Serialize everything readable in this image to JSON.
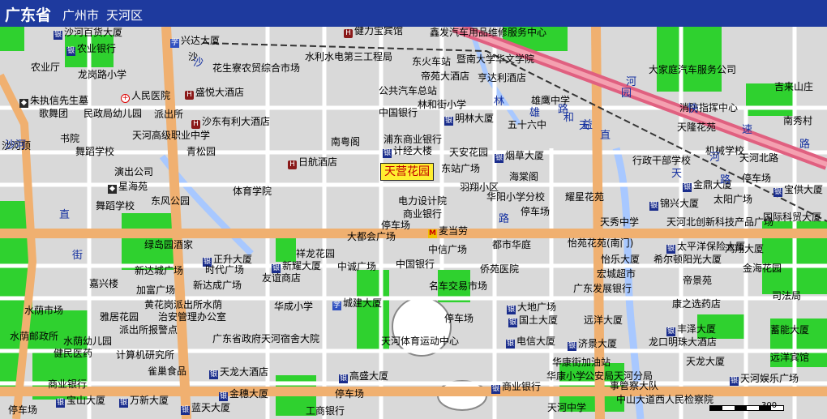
{
  "header": {
    "province": "广东省",
    "city": "广州市",
    "district": "天河区",
    "bg_color": "#1e3a9e"
  },
  "callout": "天营花园",
  "scale": "300",
  "colors": {
    "road_main": "#f0b070",
    "road_express": "#e06080",
    "road_minor": "#ffffff",
    "green": "#2fd12f",
    "water": "#a8c8ff",
    "block": "#d9d9d9"
  },
  "roads": [
    "沙河",
    "路",
    "快",
    "速",
    "直",
    "园",
    "路",
    "林",
    "和",
    "天",
    "河",
    "直",
    "街",
    "路",
    "雄",
    "益",
    "天",
    "河",
    "沙",
    "路"
  ],
  "places": {
    "p0": "沙河百货大厦",
    "p1": "兴达大厦",
    "p2": "农业银行",
    "p3": "沙",
    "p4": "农业厅",
    "p5": "龙岗路小学",
    "p6": "花生寮农贸综合市场",
    "p7": "水利水电第三工程局",
    "p8": "人民医院",
    "p9": "盛悦大酒店",
    "p10": "朱执信先生墓",
    "p11": "歌舞团",
    "p12": "民政局幼儿园",
    "p13": "派出所",
    "p14": "沙东有利大酒店",
    "p15": "天河高级职业中学",
    "p16": "书院",
    "p17": "沙河顶",
    "p18": "舞蹈学校",
    "p19": "青松园",
    "p20": "演出公司",
    "p21": "星海苑",
    "p22": "东风公园",
    "p23": "体育学院",
    "p24": "日航酒店",
    "p25": "南粤阁",
    "p26": "健力宝宾馆",
    "p27": "鑫发汽车用品维修服务中心",
    "p28": "东火车站",
    "p29": "暨南大学华文学院",
    "p30": "帝苑大酒店",
    "p31": "亨达利酒店",
    "p32": "公共汽车总站",
    "p33": "林和街小学",
    "p34": "中国银行",
    "p35": "明林大厦",
    "p36": "雄鹰中学",
    "p37": "五十六中",
    "p38": "浦东商业银行",
    "p39": "计经大楼",
    "p40": "天安花园",
    "p41": "烟草大厦",
    "p42": "机械学校",
    "p43": "东站广场",
    "p44": "行政干部学校",
    "p45": "海棠阁",
    "p46": "羽翔小区",
    "p47": "华阳小学分校",
    "p48": "耀星花苑",
    "p49": "电力设计院",
    "p50": "商业银行",
    "p51": "麦当劳",
    "p52": "停车场",
    "p53": "天秀中学",
    "p54": "天河北创新科技产品广场",
    "p55": "国际科贸大厦",
    "p56": "大都会广场",
    "p57": "中信广场",
    "p58": "都市华庭",
    "p59": "怡苑花苑(南门)",
    "p60": "太平洋保险大厦",
    "p61": "鸿翔大厦",
    "p62": "舞蹈学校",
    "p63": "绿岛园酒家",
    "p64": "正升大厦",
    "p65": "祥龙花园",
    "p66": "中国银行",
    "p67": "侨苑医院",
    "p68": "怡乐大厦",
    "p69": "希尔顿阳光大厦",
    "p70": "金海花园",
    "p71": "新达城广场",
    "p72": "时代广场",
    "p73": "新耀大厦",
    "p74": "中诚广场",
    "p75": "加富广场",
    "p76": "新达成广场",
    "p77": "友谊商店",
    "p78": "名车交易市场",
    "p79": "宏城超市",
    "p80": "广东发展银行",
    "p81": "帝景苑",
    "p82": "司法局",
    "p83": "嘉兴楼",
    "p84": "黄花岗派出所水荫",
    "p85": "华成小学",
    "p86": "城建大厦",
    "p87": "大地广场",
    "p88": "康之选药店",
    "p89": "水荫市场",
    "p90": "雅居花园",
    "p91": "治安管理办公室",
    "p92": "天河体育运动中心",
    "p93": "国土大厦",
    "p94": "远洋大厦",
    "p95": "水荫邮政所",
    "p96": "水荫幼儿园",
    "p97": "派出所报警点",
    "p98": "广东省政府天河宿舍大院",
    "p99": "济景大厦",
    "p100": "电信大厦",
    "p101": "丰泽大厦",
    "p102": "蓄能大厦",
    "p103": "健民医药",
    "p104": "计算机研究所",
    "p105": "雀巢食品",
    "p106": "华康街加油站",
    "p107": "龙口明珠大酒店",
    "p108": "天龙大厦",
    "p109": "远洋宾馆",
    "p110": "商业银行",
    "p111": "天龙大酒店",
    "p112": "高盛大厦",
    "p113": "华康小学",
    "p114": "公安局天河分局",
    "p115": "事管察大队",
    "p116": "天河娱乐广场",
    "p117": "宝山大厦",
    "p118": "万新大厦",
    "p119": "金穗大厦",
    "p120": "商业银行",
    "p121": "中山大道西人民检察院",
    "p122": "蓝天大厦",
    "p123": "工商银行",
    "p124": "天河中学",
    "p125": "停车场",
    "p126": "宝供大厦",
    "p127": "金鼎大厦",
    "p128": "太阳广场",
    "p129": "锦兴大厦",
    "p130": "停车场",
    "p131": "南秀村",
    "p132": "吉来山庄",
    "p133": "消防指挥中心",
    "p134": "天隆花苑",
    "p135": "大家庭汽车服务公司",
    "p136": "天河北路",
    "p137": "停车场",
    "p138": "停车场",
    "p139": "停车场"
  }
}
